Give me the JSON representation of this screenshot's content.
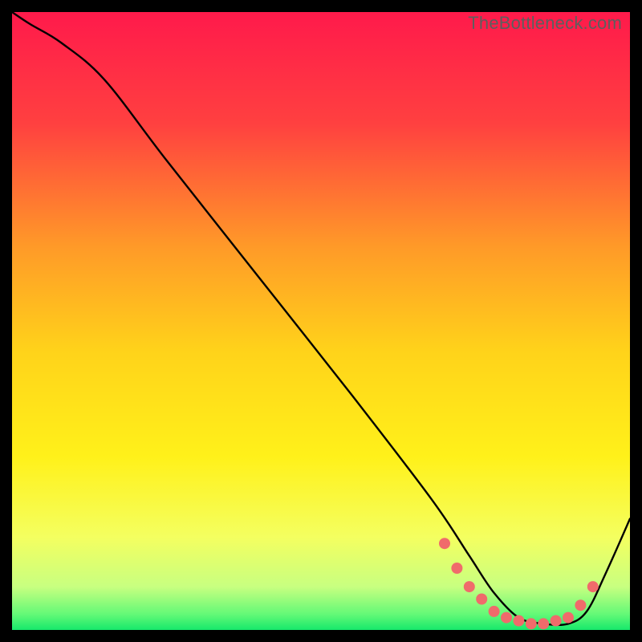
{
  "watermark": "TheBottleneck.com",
  "chart_data": {
    "type": "line",
    "title": "",
    "xlabel": "",
    "ylabel": "",
    "xlim": [
      0,
      100
    ],
    "ylim": [
      0,
      100
    ],
    "grid": false,
    "legend": false,
    "gradient_stops": [
      {
        "offset": 0.0,
        "color": "#ff1a4b"
      },
      {
        "offset": 0.18,
        "color": "#ff4040"
      },
      {
        "offset": 0.38,
        "color": "#ff9a28"
      },
      {
        "offset": 0.55,
        "color": "#ffd31a"
      },
      {
        "offset": 0.72,
        "color": "#fff11a"
      },
      {
        "offset": 0.85,
        "color": "#f4ff60"
      },
      {
        "offset": 0.93,
        "color": "#c8ff80"
      },
      {
        "offset": 0.975,
        "color": "#62f977"
      },
      {
        "offset": 1.0,
        "color": "#17e86b"
      }
    ],
    "series": [
      {
        "name": "bottleneck-curve",
        "x": [
          0,
          3,
          8,
          15,
          25,
          40,
          55,
          68,
          74,
          78,
          82,
          86,
          90,
          93,
          96,
          100
        ],
        "y": [
          100,
          98,
          95,
          89,
          76,
          57,
          38,
          21,
          12,
          6,
          2,
          1,
          1,
          3,
          9,
          18
        ]
      }
    ],
    "markers": {
      "name": "highlight-dots",
      "color": "#f06b6b",
      "x": [
        70,
        72,
        74,
        76,
        78,
        80,
        82,
        84,
        86,
        88,
        90,
        92,
        94
      ],
      "y": [
        14,
        10,
        7,
        5,
        3,
        2,
        1.5,
        1,
        1,
        1.5,
        2,
        4,
        7
      ]
    }
  }
}
